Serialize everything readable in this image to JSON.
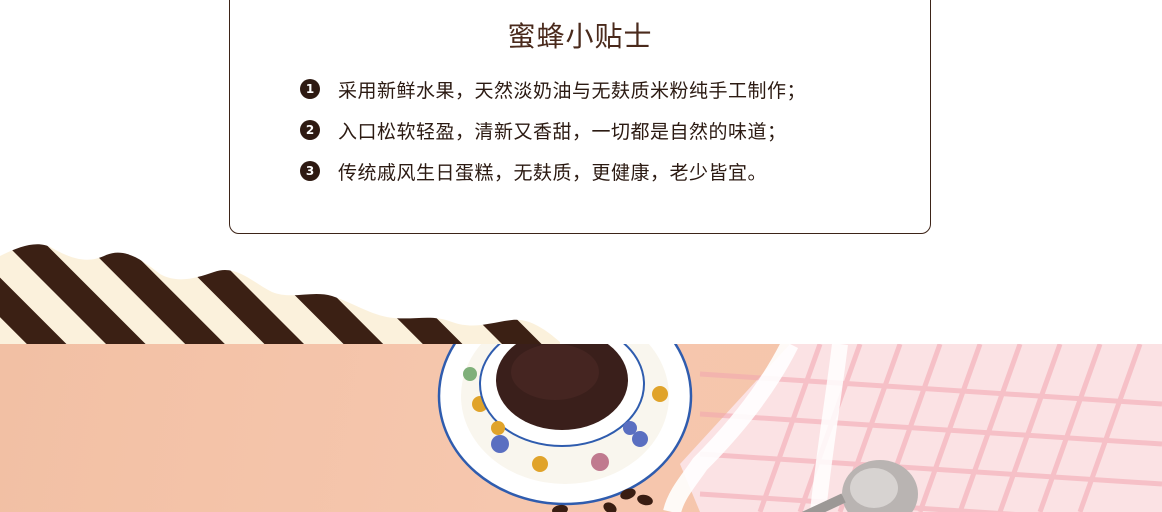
{
  "tips": {
    "title": "蜜蜂小贴士",
    "items": [
      {
        "number": "1",
        "text": "采用新鲜水果，天然淡奶油与无麸质米粉纯手工制作；"
      },
      {
        "number": "2",
        "text": "入口松软轻盈，清新又香甜，一切都是自然的味道；"
      },
      {
        "number": "3",
        "text": "传统戚风生日蛋糕，无麸质，更健康，老少皆宜。"
      }
    ]
  },
  "colors": {
    "border": "#3d2418",
    "stripe_dark": "#3b2014",
    "stripe_light": "#fbf1dc",
    "background_peach": "#f4c4aa"
  }
}
